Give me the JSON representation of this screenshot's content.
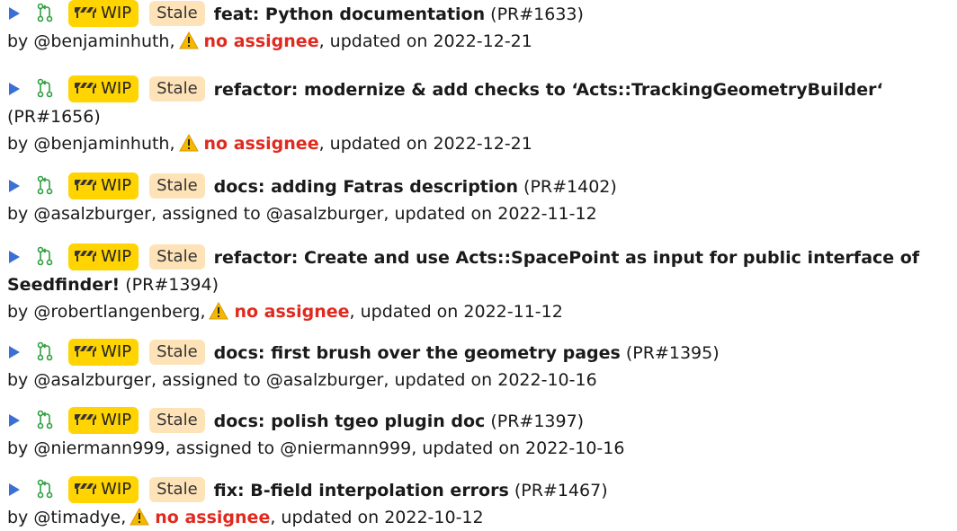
{
  "labels": {
    "wip": "WIP",
    "stale": "Stale",
    "by": "by",
    "assigned_to": "assigned to",
    "no_assignee": "no assignee",
    "updated_on": "updated on",
    "pr_prefix": "PR#"
  },
  "colors": {
    "wip_badge": "#ffd400",
    "stale_badge": "#ffe3b8",
    "expand_arrow": "#3a6fd6",
    "pr_icon": "#2e9e3e",
    "no_assignee": "#e02a1f"
  },
  "icons": {
    "expand": "triangle-right-icon",
    "pr": "pull-request-icon",
    "wip": "construction-icon",
    "warning": "warning-icon"
  },
  "pull_requests": [
    {
      "title": "feat: Python documentation",
      "number": "(PR#1633)",
      "author": "@benjaminhuth",
      "assignee": "",
      "updated": "2022-12-21"
    },
    {
      "title": "refactor: modernize & add checks to ‘Acts::TrackingGeometryBuilder‘",
      "number": "(PR#1656)",
      "author": "@benjaminhuth",
      "assignee": "",
      "updated": "2022-12-21"
    },
    {
      "title": "docs: adding Fatras description",
      "number": "(PR#1402)",
      "author": "@asalzburger",
      "assignee": "@asalzburger",
      "updated": "2022-11-12"
    },
    {
      "title_line1": "refactor: Create and use Acts::SpacePoint as input for public interface of",
      "title_line2": "Seedfinder!",
      "number": "(PR#1394)",
      "author": "@robertlangenberg",
      "assignee": "",
      "updated": "2022-11-12"
    },
    {
      "title": "docs: first brush over the geometry pages",
      "number": "(PR#1395)",
      "author": "@asalzburger",
      "assignee": "@asalzburger",
      "updated": "2022-10-16"
    },
    {
      "title": "docs: polish tgeo plugin doc",
      "number": "(PR#1397)",
      "author": "@niermann999",
      "assignee": "@niermann999",
      "updated": "2022-10-16"
    },
    {
      "title": "fix: B-field interpolation errors",
      "number": "(PR#1467)",
      "author": "@timadye",
      "assignee": "",
      "updated": "2022-10-12"
    }
  ]
}
